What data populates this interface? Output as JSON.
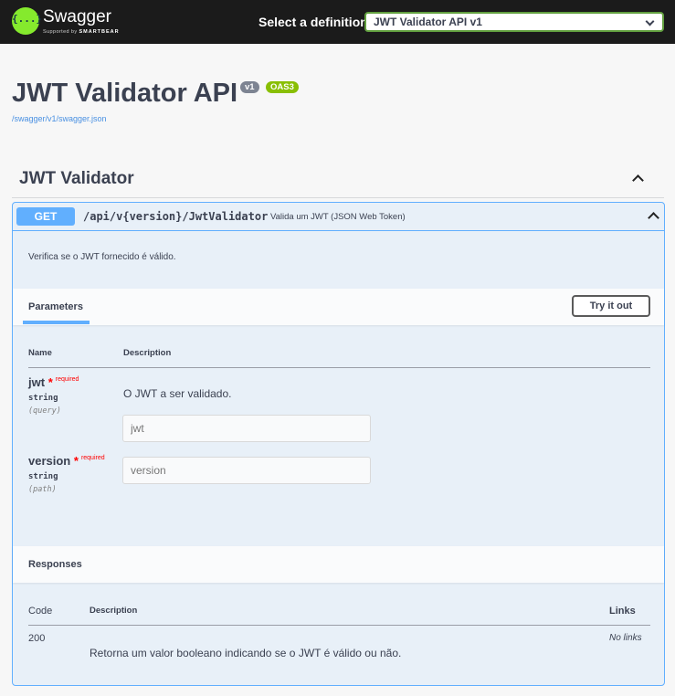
{
  "topbar": {
    "brand": "Swagger",
    "brand_sub_prefix": "Supported by",
    "brand_sub_name": "SMARTBEAR",
    "logo_glyph": "{...}",
    "definition_label": "Select a definition",
    "definition_selected": "JWT Validator API v1"
  },
  "info": {
    "title": "JWT Validator API",
    "version_badge": "v1",
    "oas_badge": "OAS3",
    "spec_link": "/swagger/v1/swagger.json"
  },
  "tag": {
    "name": "JWT Validator"
  },
  "operation": {
    "method": "GET",
    "path": "/api/v{version}/JwtValidator",
    "summary": "Valida um JWT (JSON Web Token)",
    "description": "Verifica se o JWT fornecido é válido."
  },
  "parameters": {
    "tab_label": "Parameters",
    "try_button": "Try it out",
    "col_name": "Name",
    "col_description": "Description",
    "items": [
      {
        "name": "jwt",
        "star": "*",
        "required": "required",
        "type": "string",
        "in": "(query)",
        "description": "O JWT a ser validado.",
        "placeholder": "jwt"
      },
      {
        "name": "version",
        "star": "*",
        "required": "required",
        "type": "string",
        "in": "(path)",
        "description": "",
        "placeholder": "version"
      }
    ]
  },
  "responses": {
    "title": "Responses",
    "col_code": "Code",
    "col_description": "Description",
    "col_links": "Links",
    "items": [
      {
        "code": "200",
        "description": "Retorna um valor booleano indicando se o JWT é válido ou não.",
        "links": "No links"
      }
    ]
  },
  "colors": {
    "topbar_bg": "#1b1b1b",
    "logo_green": "#85ea2d",
    "get_blue": "#61affe",
    "oas_green": "#89bf04",
    "version_gray": "#7d8492",
    "required_red": "#ff0000"
  },
  "icons": {
    "select_chevron": "chevron-down-icon",
    "tag_toggle": "chevron-up-icon",
    "operation_toggle": "chevron-up-icon"
  }
}
